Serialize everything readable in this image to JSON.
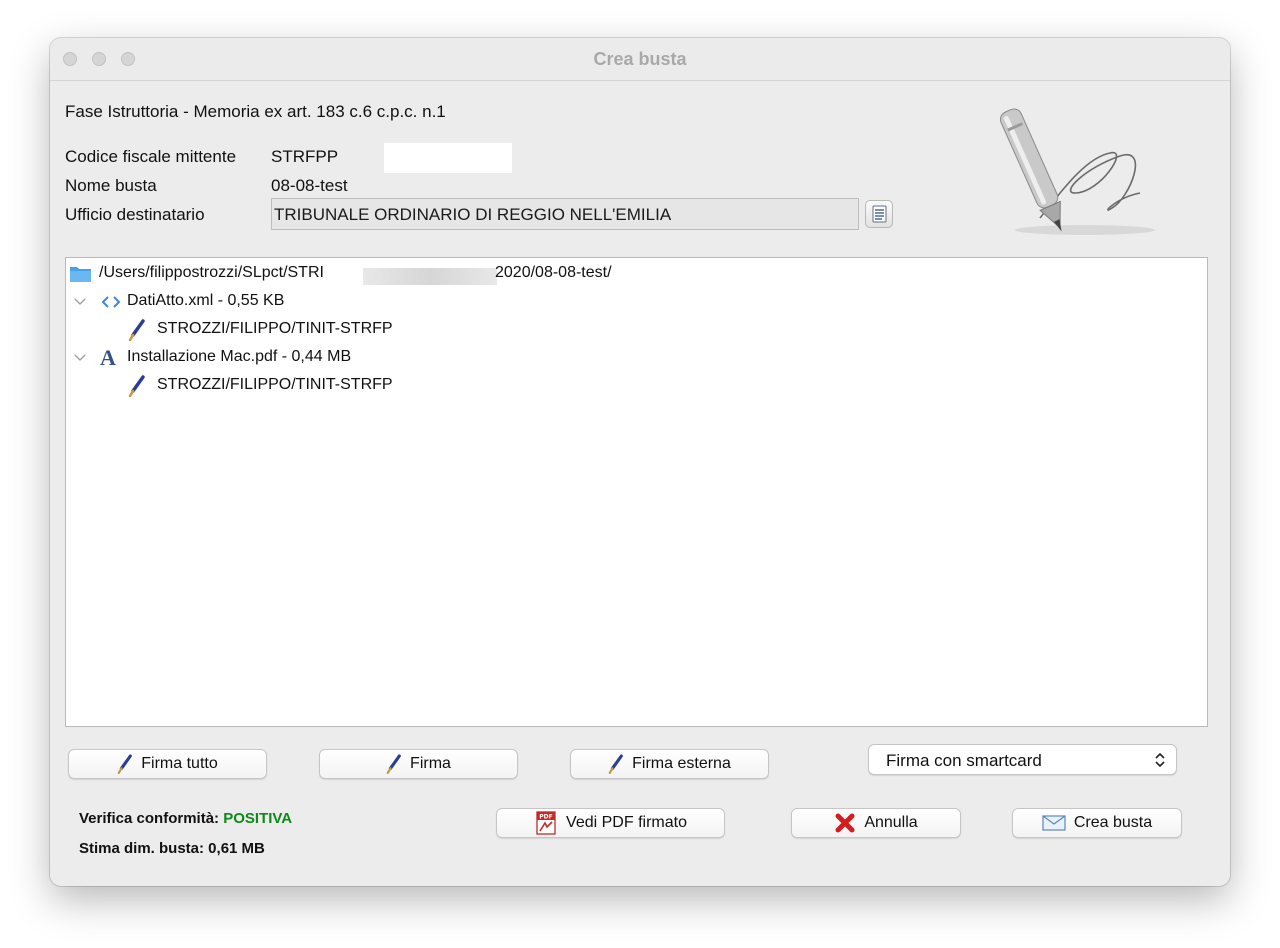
{
  "window": {
    "title": "Crea busta"
  },
  "header": {
    "fase": "Fase Istruttoria - Memoria ex art. 183 c.6 c.p.c. n.1",
    "codice_fiscale_label": "Codice fiscale mittente",
    "codice_fiscale_value": "STRFPP",
    "nome_busta_label": "Nome busta",
    "nome_busta_value": "08-08-test",
    "ufficio_label": "Ufficio destinatario",
    "ufficio_value": "TRIBUNALE ORDINARIO DI REGGIO NELL'EMILIA"
  },
  "tree": {
    "root_path_start": "/Users/filippostrozzi/SLpct/STRI",
    "root_path_end": "2020/08-08-test/",
    "items": [
      {
        "label": "DatiAtto.xml - 0,55 KB",
        "signer": "STROZZI/FILIPPO/TINIT-STRFP",
        "icon": "xml-code-icon"
      },
      {
        "label": "Installazione Mac.pdf - 0,44 MB",
        "signer": "STROZZI/FILIPPO/TINIT-STRFP",
        "icon": "pdf-a-icon"
      }
    ]
  },
  "actions": {
    "firma_tutto": "Firma tutto",
    "firma": "Firma",
    "firma_esterna": "Firma esterna",
    "firma_mode": "Firma con smartcard",
    "vedi_pdf": "Vedi PDF firmato",
    "annulla": "Annulla",
    "crea_busta": "Crea busta"
  },
  "status": {
    "verifica_label": "Verifica conformità:",
    "verifica_value": "POSITIVA",
    "stima_label": "Stima dim. busta: 0,61 MB"
  },
  "colors": {
    "positive": "#0f8a18",
    "window_bg": "#ececec",
    "title_text": "#a9a9a9"
  }
}
